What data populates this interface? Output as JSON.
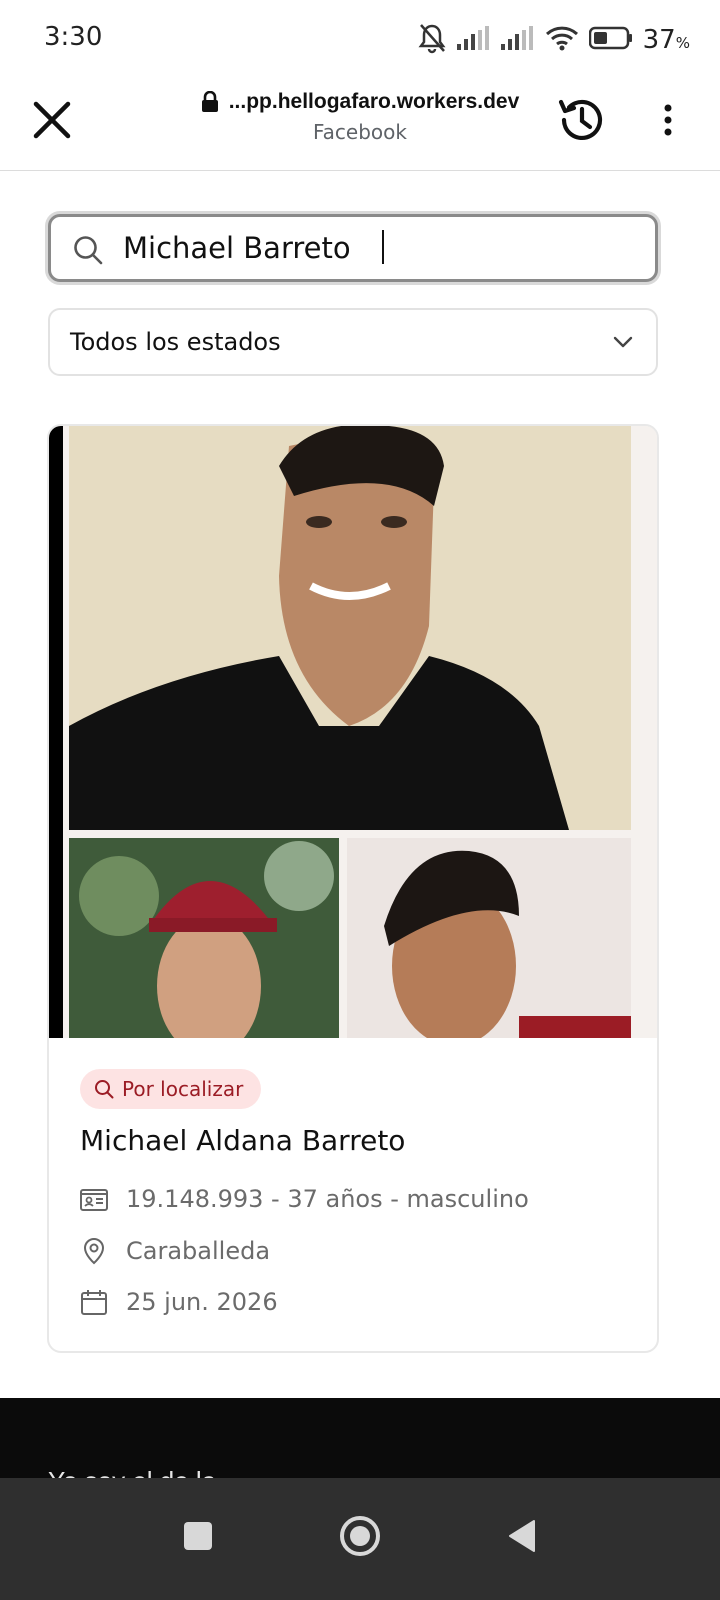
{
  "status_bar": {
    "time": "3:30",
    "battery_percent": "37",
    "battery_unit": "%",
    "icons": [
      "bell-off-icon",
      "signal-icon",
      "signal-icon",
      "wifi-icon",
      "battery-icon"
    ]
  },
  "browser": {
    "url": "...pp.hellogafaro.workers.dev",
    "site_name": "Facebook",
    "icons": [
      "close-icon",
      "lock-icon",
      "history-icon",
      "more-vert-icon"
    ]
  },
  "search": {
    "value": "Michael Barreto"
  },
  "filter": {
    "selected": "Todos los estados"
  },
  "card": {
    "badge_label": "Por localizar",
    "name": "Michael Aldana Barreto",
    "id_line": "19.148.993 - 37 años - masculino",
    "location": "Caraballeda",
    "date": "25 jun. 2026"
  },
  "footer": {
    "partial_text": "Yo soy el de la                                                  "
  },
  "colors": {
    "badge_bg": "#fde3e3",
    "badge_text": "#9b1c25",
    "nav_bar": "#2f2f2f",
    "footer_bg": "#0b0b0b"
  }
}
